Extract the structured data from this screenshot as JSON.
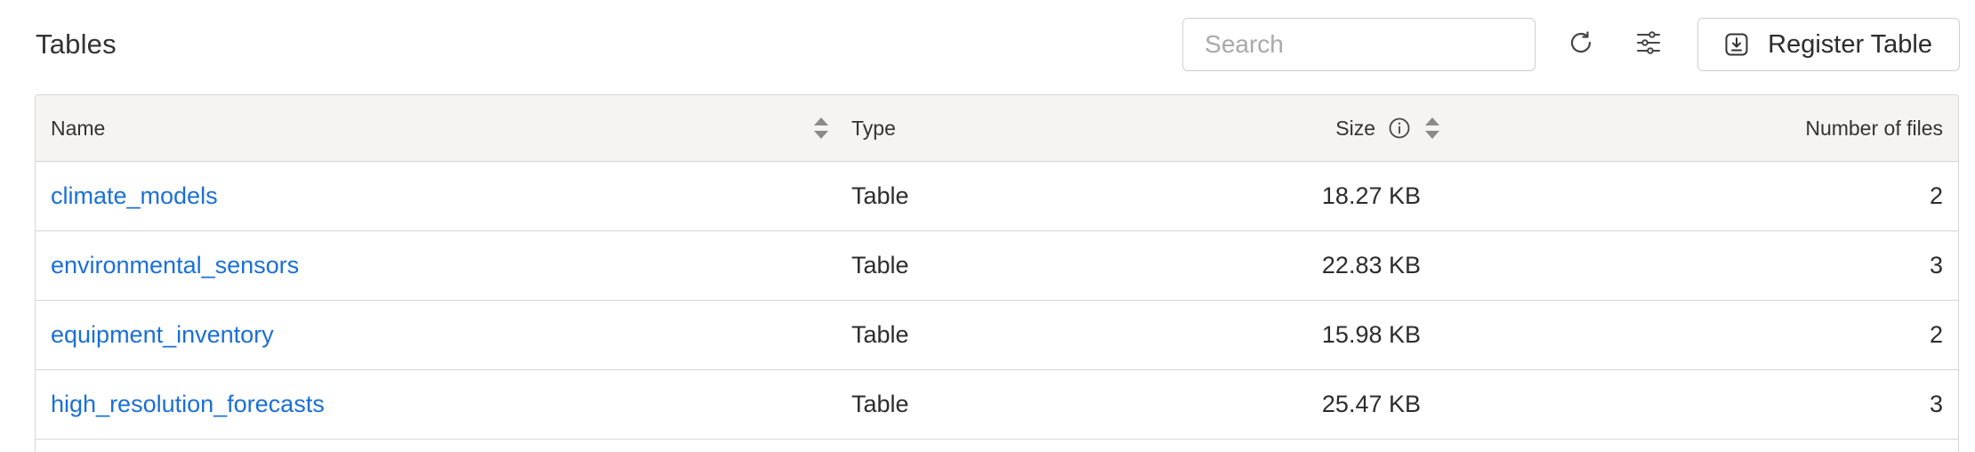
{
  "header": {
    "title": "Tables",
    "search_placeholder": "Search",
    "search_value": "",
    "register_label": "Register Table",
    "icons": {
      "refresh": "refresh-icon",
      "filter": "sliders-icon",
      "register": "download-box-icon"
    }
  },
  "table": {
    "columns": {
      "name": "Name",
      "type": "Type",
      "size": "Size",
      "files": "Number of files"
    },
    "rows": [
      {
        "name": "climate_models",
        "type": "Table",
        "size": "18.27 KB",
        "files": "2"
      },
      {
        "name": "environmental_sensors",
        "type": "Table",
        "size": "22.83 KB",
        "files": "3"
      },
      {
        "name": "equipment_inventory",
        "type": "Table",
        "size": "15.98 KB",
        "files": "2"
      },
      {
        "name": "high_resolution_forecasts",
        "type": "Table",
        "size": "25.47 KB",
        "files": "3"
      }
    ]
  },
  "colors": {
    "link": "#1a6fd6",
    "header_bg": "#f5f4f2",
    "border": "#d6d6d6"
  }
}
